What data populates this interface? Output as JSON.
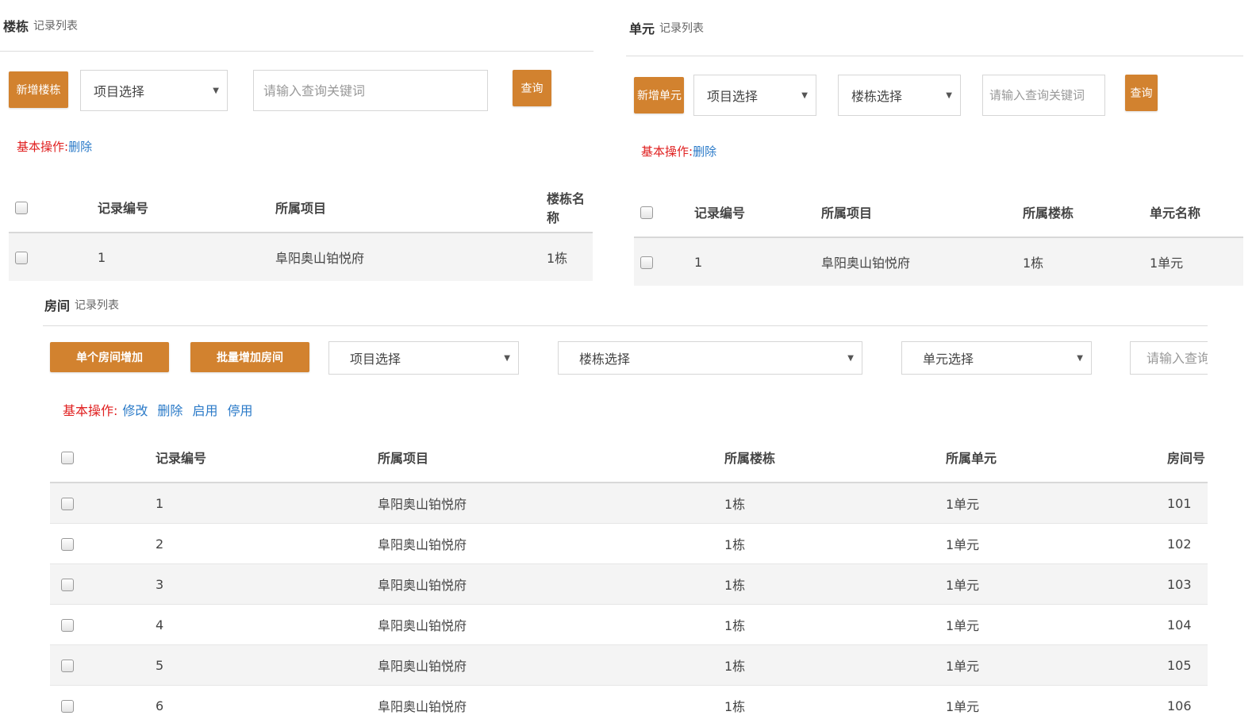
{
  "building_panel": {
    "title": "楼栋",
    "subtitle": "记录列表",
    "add_label": "新增楼栋",
    "project_select": "项目选择",
    "search_placeholder": "请输入查询关键词",
    "query_label": "查询",
    "ops_label": "基本操作:",
    "delete_label": "删除",
    "columns": [
      "记录编号",
      "所属项目",
      "楼栋名称"
    ],
    "rows": [
      {
        "id": "1",
        "project": "阜阳奥山铂悦府",
        "building": "1栋"
      }
    ]
  },
  "unit_panel": {
    "title": "单元",
    "subtitle": "记录列表",
    "add_label": "新增单元",
    "project_select": "项目选择",
    "building_select": "楼栋选择",
    "search_placeholder": "请输入查询关键词",
    "query_label": "查询",
    "ops_label": "基本操作:",
    "delete_label": "删除",
    "columns": [
      "记录编号",
      "所属项目",
      "所属楼栋",
      "单元名称"
    ],
    "rows": [
      {
        "id": "1",
        "project": "阜阳奥山铂悦府",
        "building": "1栋",
        "unit": "1单元"
      }
    ]
  },
  "room_panel": {
    "title": "房间",
    "subtitle": "记录列表",
    "add_single_label": "单个房间增加",
    "add_batch_label": "批量增加房间",
    "project_select": "项目选择",
    "building_select": "楼栋选择",
    "unit_select": "单元选择",
    "search_placeholder": "请输入查询关键词",
    "ops_label": "基本操作:",
    "edit_label": "修改",
    "delete_label": "删除",
    "enable_label": "启用",
    "disable_label": "停用",
    "columns": [
      "记录编号",
      "所属项目",
      "所属楼栋",
      "所属单元",
      "房间号"
    ],
    "rows": [
      {
        "id": "1",
        "project": "阜阳奥山铂悦府",
        "building": "1栋",
        "unit": "1单元",
        "room": "101"
      },
      {
        "id": "2",
        "project": "阜阳奥山铂悦府",
        "building": "1栋",
        "unit": "1单元",
        "room": "102"
      },
      {
        "id": "3",
        "project": "阜阳奥山铂悦府",
        "building": "1栋",
        "unit": "1单元",
        "room": "103"
      },
      {
        "id": "4",
        "project": "阜阳奥山铂悦府",
        "building": "1栋",
        "unit": "1单元",
        "room": "104"
      },
      {
        "id": "5",
        "project": "阜阳奥山铂悦府",
        "building": "1栋",
        "unit": "1单元",
        "room": "105"
      },
      {
        "id": "6",
        "project": "阜阳奥山铂悦府",
        "building": "1栋",
        "unit": "1单元",
        "room": "106"
      }
    ]
  },
  "colors": {
    "accent": "#d2822f",
    "ops_label": "#e02020",
    "link": "#2a7ac8"
  }
}
